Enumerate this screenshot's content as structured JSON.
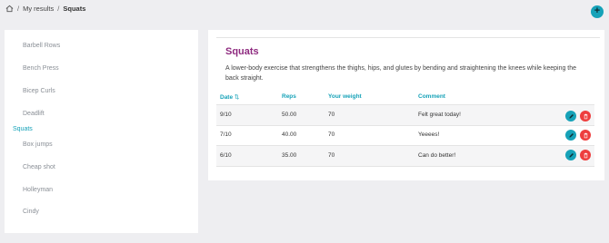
{
  "breadcrumb": {
    "home_icon": "home-icon",
    "parent": "My results",
    "separator": "/",
    "current": "Squats"
  },
  "fab": {
    "icon": "plus-icon",
    "label": "+"
  },
  "sidebar": {
    "items": [
      {
        "label": "Barbell Rows",
        "active": false
      },
      {
        "label": "Bench Press",
        "active": false
      },
      {
        "label": "Bicep Curls",
        "active": false
      },
      {
        "label": "Deadlift",
        "active": false
      },
      {
        "label": "Squats",
        "active": true
      },
      {
        "label": "Box jumps",
        "active": false
      },
      {
        "label": "Cheap shot",
        "active": false
      },
      {
        "label": "Holleyman",
        "active": false
      },
      {
        "label": "Cindy",
        "active": false
      }
    ]
  },
  "exercise": {
    "title": "Squats",
    "description": "A lower-body exercise that strengthens the thighs, hips, and glutes by bending and straightening the knees while keeping the back straight."
  },
  "table": {
    "headers": {
      "date": "Date",
      "sort_indicator": "⇅",
      "reps": "Reps",
      "weight": "Your weight",
      "comment": "Comment"
    },
    "rows": [
      {
        "date": "9/10",
        "reps": "50.00",
        "weight": "70",
        "comment": "Felt great today!"
      },
      {
        "date": "7/10",
        "reps": "40.00",
        "weight": "70",
        "comment": "Yeeees!"
      },
      {
        "date": "6/10",
        "reps": "35.00",
        "weight": "70",
        "comment": "Can do better!"
      }
    ]
  },
  "colors": {
    "accent": "#16a2b8",
    "title": "#8e2a7f",
    "danger": "#ee3e3e",
    "background": "#eeeef1"
  }
}
